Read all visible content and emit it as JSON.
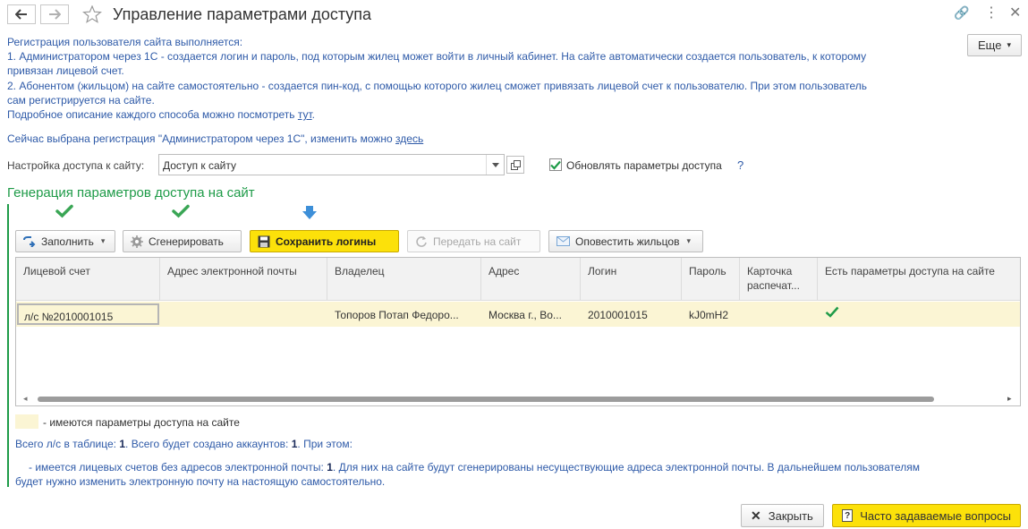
{
  "window": {
    "title": "Управление параметрами доступа",
    "more_label": "Еще"
  },
  "info": {
    "line1": "Регистрация пользователя сайта выполняется:",
    "line2": "1. Администратором через 1С - создается логин и пароль, под которым жилец может войти в личный кабинет. На сайте автоматически создается пользователь, к которому",
    "line3": "привязан лицевой счет.",
    "line4": "2. Абонентом (жильцом) на сайте самостоятельно - создается пин-код, с помощью которого жилец сможет привязать лицевой счет к пользователю. При этом пользователь",
    "line5": "сам регистрируется на сайте.",
    "line6_prefix": "Подробное описание каждого способа можно посмотреть ",
    "line6_link": "тут",
    "line6_suffix": ".",
    "current_prefix": "Сейчас выбрана регистрация \"Администратором через 1С\", изменить можно ",
    "current_link": "здесь"
  },
  "access": {
    "label": "Настройка доступа к сайту:",
    "value": "Доступ к сайту",
    "update_checkbox_label": "Обновлять параметры доступа",
    "update_checked": true,
    "help": "?"
  },
  "group": {
    "title": "Генерация параметров доступа на сайт"
  },
  "toolbar": {
    "fill": "Заполнить",
    "generate": "Сгенерировать",
    "save_logins": "Сохранить логины",
    "send_to_site": "Передать на сайт",
    "notify": "Оповестить жильцов"
  },
  "table": {
    "headers": [
      "Лицевой счет",
      "Адрес электронной почты",
      "Владелец",
      "Адрес",
      "Логин",
      "Пароль",
      "Карточка распечат...",
      "Есть параметры доступа на сайте"
    ],
    "rows": [
      {
        "account": "л/с №2010001015",
        "email": "",
        "owner": "Топоров Потап Федоро...",
        "address": "Москва г., Во...",
        "login": "2010001015",
        "password": "kJ0mH2",
        "card": "",
        "has_access": true
      }
    ]
  },
  "legend": {
    "text": "- имеются параметры доступа на сайте",
    "color": "#fbf5d4"
  },
  "summary": {
    "p1": "Всего л/с в таблице: ",
    "v1": "1",
    "p2": ". Всего будет создано аккаунтов: ",
    "v2": "1",
    "p3": ". При этом:",
    "n1": "- имеется лицевых счетов без адресов электронной почты: ",
    "nv": "1",
    "n2": ". Для них на сайте будут сгенерированы несуществующие адреса электронной почты. В дальнейшем пользователям",
    "n3": "будет нужно изменить электронную почту на настоящую самостоятельно."
  },
  "footer": {
    "close": "Закрыть",
    "faq": "Часто задаваемые вопросы"
  },
  "colors": {
    "accent_green": "#1e9b48",
    "link_blue": "#2e5aa8",
    "primary_yellow": "#fce10a"
  }
}
